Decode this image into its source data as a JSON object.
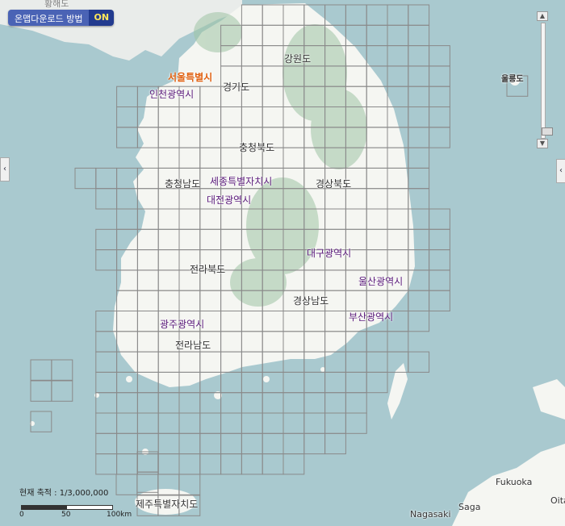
{
  "map_toggle": {
    "label": "온맵다운로드 방법",
    "state": "ON"
  },
  "labels": {
    "gangwon": "강원도",
    "seoul": "서울특별시",
    "gyeonggi": "경기도",
    "incheon": "인천광역시",
    "ulleung": "울릉도",
    "chungbuk": "충청북도",
    "chungnam": "충청남도",
    "sejong": "세종특별자치시",
    "gyeongbuk": "경상북도",
    "daejeon": "대전광역시",
    "daegu": "대구광역시",
    "jeonbuk": "전라북도",
    "ulsan": "울산광역시",
    "gyeongnam": "경상남도",
    "busan": "부산광역시",
    "gwangju": "광주광역시",
    "jeonnam": "전라남도",
    "jeju": "제주특별자치도",
    "fukuoka": "Fukuoka",
    "saga": "Saga",
    "nagasaki": "Nagasaki",
    "oita": "Oita",
    "top_left_partial": "황해도"
  },
  "scale": {
    "text": "현재 축적 : 1/3,000,000",
    "tick0": "0",
    "tick50": "50",
    "tick100": "100km"
  },
  "zoom": {
    "level_fraction": 0.95,
    "up": "▲",
    "down": "▼"
  },
  "side_tabs": {
    "left": "‹",
    "right": "‹"
  },
  "colors": {
    "sea": "#a9c9cf",
    "land": "#f5f6f2",
    "grid": "#8a8a8a",
    "mountain": "#9fc4a4"
  }
}
